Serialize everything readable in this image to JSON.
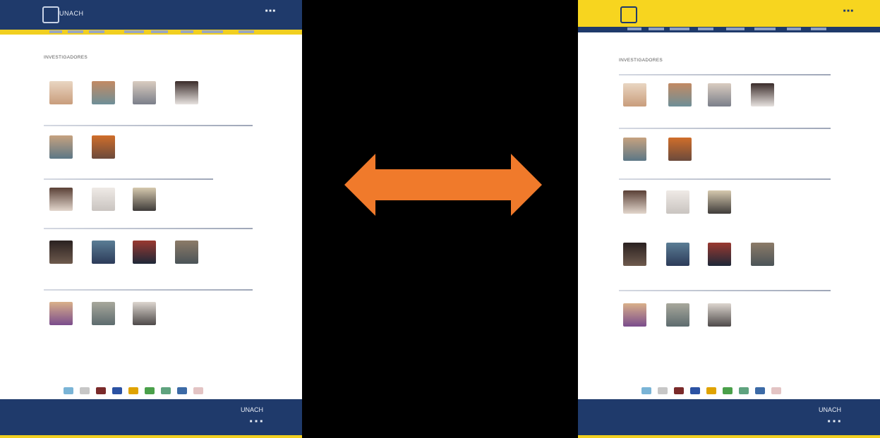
{
  "header": {
    "brand": "UNACH",
    "right_text": "■ ■ ■"
  },
  "page": {
    "title": "INVESTIGADORES"
  },
  "footer": {
    "brand": "UNACH",
    "icons": "■ ■ ■"
  },
  "colors": {
    "navy": "#1f3a6b",
    "yellow": "#f1cf20",
    "arrow": "#f07a2b",
    "background": "#000000"
  },
  "icons": {
    "arrow": "double-headed-arrow-icon"
  }
}
